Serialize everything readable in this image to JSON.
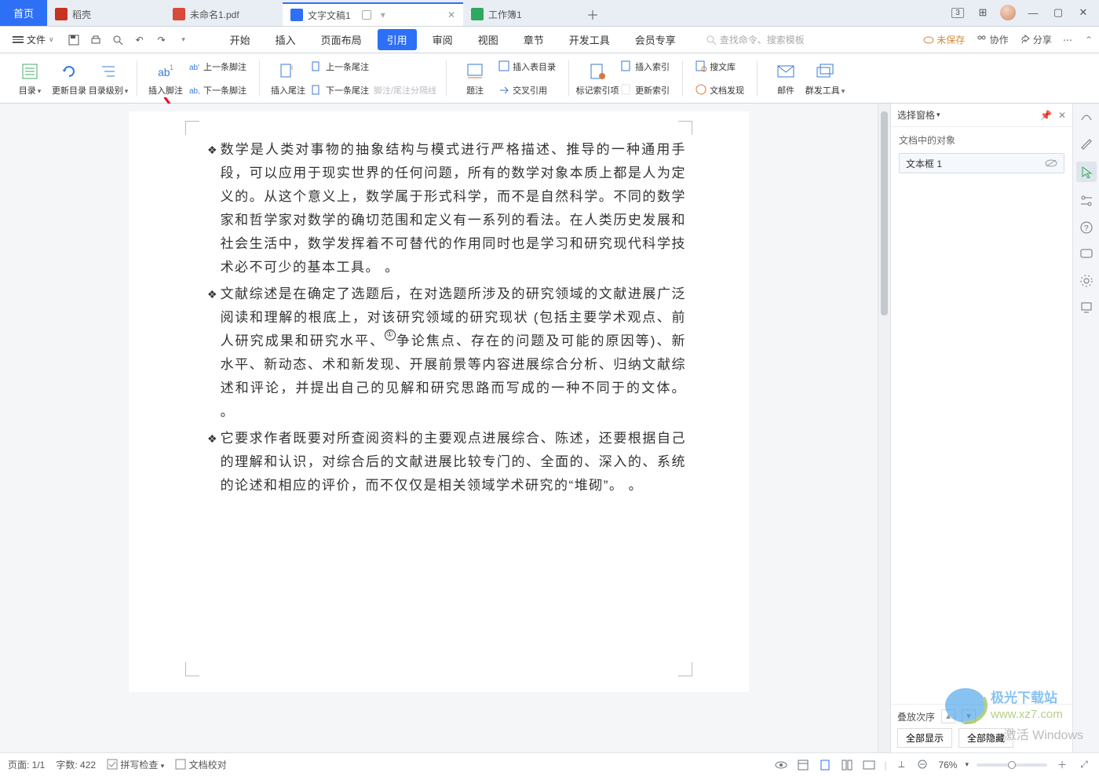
{
  "tabs": {
    "home": "首页",
    "t1": "稻壳",
    "t2": "未命名1.pdf",
    "t3": "文字文稿1",
    "t4": "工作簿1"
  },
  "win": {
    "badge": "3"
  },
  "file_menu": "文件",
  "menus": {
    "start": "开始",
    "insert": "插入",
    "layout": "页面布局",
    "ref": "引用",
    "review": "审阅",
    "view": "视图",
    "chapter": "章节",
    "dev": "开发工具",
    "vip": "会员专享"
  },
  "search_placeholder": "查找命令、搜索模板",
  "topright": {
    "unsaved": "未保存",
    "coop": "协作",
    "share": "分享"
  },
  "ribbon": {
    "toc": "目录",
    "update_toc": "更新目录",
    "toc_level": "目录级别",
    "insert_footnote": "插入脚注",
    "prev_footnote": "上一条脚注",
    "next_footnote": "下一条脚注",
    "insert_tailnote": "插入尾注",
    "prev_tailnote": "上一条尾注",
    "next_tailnote": "下一条尾注",
    "fn_sep": "脚注/尾注分隔线",
    "caption": "题注",
    "insert_table_toc": "插入表目录",
    "crossref": "交叉引用",
    "mark_index": "标记索引项",
    "insert_index": "插入索引",
    "update_index": "更新索引",
    "search_lib": "搜文库",
    "doc_discover": "文档发现",
    "mail": "邮件",
    "mass_tools": "群发工具"
  },
  "doc": {
    "bullet": "❖",
    "p1": "数学是人类对事物的抽象结构与模式进行严格描述、推导的一种通用手段，可以应用于现实世界的任何问题，所有的数学对象本质上都是人为定义的。从这个意义上，数学属于形式科学，而不是自然科学。不同的数学家和哲学家对数学的确切范围和定义有一系列的看法。在人类历史发展和社会生活中，数学发挥着不可替代的作用同时也是学习和研究现代科学技术必不可少的基本工具。 。",
    "p2a": "文献综述是在确定了选题后，在对选题所涉及的研究领域的文献进展广泛阅读和理解的根底上，对该研究领域的研究现状 (包括主要学术观点、前人研究成果和研究水平、",
    "p2_super": "①",
    "p2b": "争论焦点、存在的问题及可能的原因等)、新水平、新动态、术和新发现、开展前景等内容进展综合分析、归纳文献综述和评论，并提出自己的见解和研究思路而写成的一种不同于的文体。 。",
    "p3": "它要求作者既要对所查阅资料的主要观点进展综合、陈述，还要根据自己的理解和认识，对综合后的文献进展比较专门的、全面的、深入的、系统的论述和相应的评价，而不仅仅是相关领域学术研究的“堆砌”。 。"
  },
  "panel": {
    "title": "选择窗格",
    "sub": "文档中的对象",
    "item1": "文本框 1",
    "stack": "叠放次序",
    "show_all": "全部显示",
    "hide_all": "全部隐藏"
  },
  "status": {
    "page": "页面: 1/1",
    "words": "字数: 422",
    "spell": "拼写检查",
    "proof": "文档校对",
    "zoom": "76%"
  },
  "watermark": {
    "l1": "激活 Windows",
    "l2": "www.xz7.com",
    "brand": "极光下载站"
  }
}
